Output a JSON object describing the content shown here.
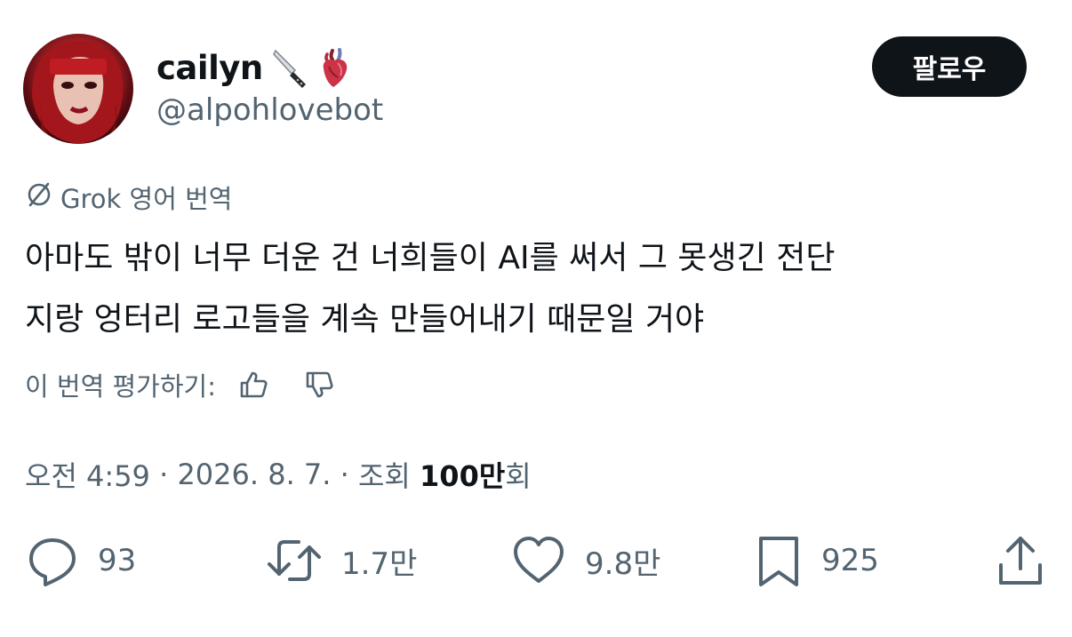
{
  "author": {
    "display_name": "cailyn",
    "handle": "@alpohlovebot",
    "emojis": [
      "knife-emoji",
      "anatomical-heart-emoji"
    ]
  },
  "follow_button": {
    "label": "팔로우"
  },
  "translation": {
    "source_label": "Grok 영어 번역",
    "icon": "grok-icon",
    "rate_label": "이 번역 평가하기:"
  },
  "tweet": {
    "text": "아마도 밖이 너무 더운 건 너희들이 AI를 써서 그 못생긴 전단\n지랑 엉터리 로고들을 계속 만들어내기 때문일 거야"
  },
  "meta": {
    "time": "오전 4:59",
    "date": "2026. 8. 7.",
    "views_label": "조회",
    "views_count": "100만",
    "views_suffix": "회",
    "separator": "·"
  },
  "actions": {
    "reply_count": "93",
    "retweet_count": "1.7만",
    "like_count": "9.8만",
    "bookmark_count": "925"
  },
  "colors": {
    "text": "#0f1419",
    "secondary": "#536471",
    "button_bg": "#0f1419",
    "background": "#ffffff"
  }
}
